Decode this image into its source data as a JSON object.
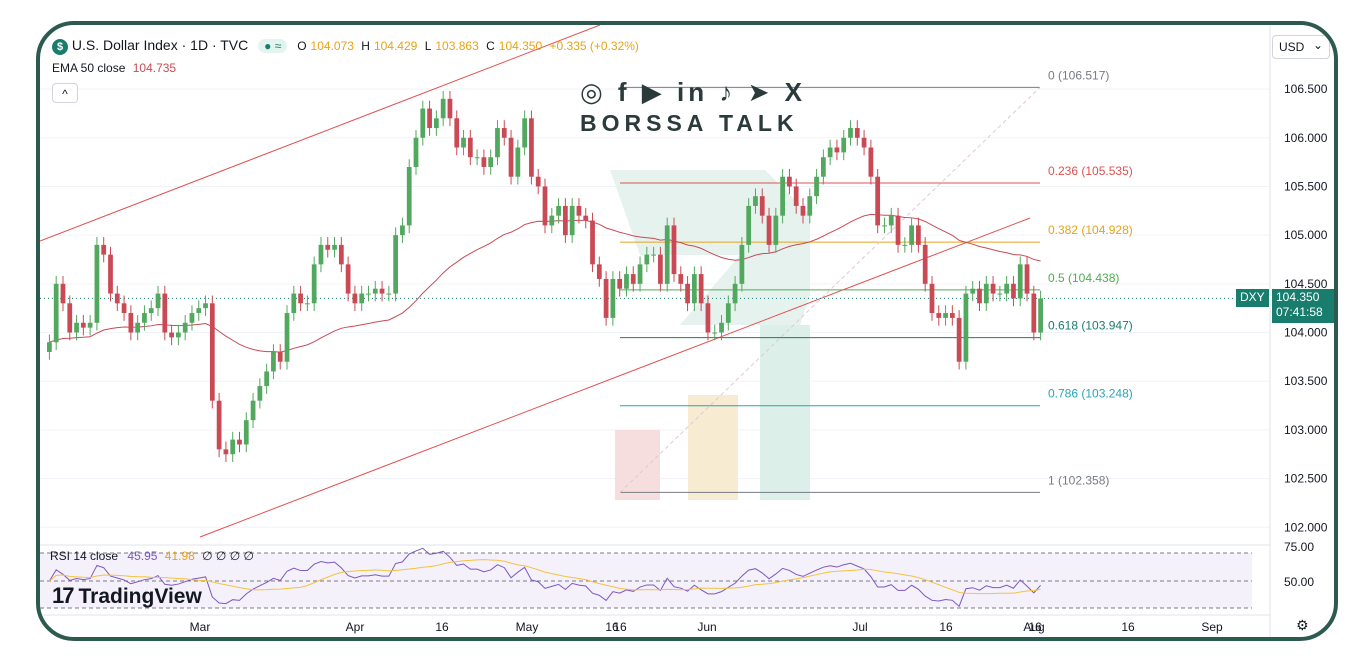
{
  "header": {
    "title": "U.S. Dollar Index · 1D · TVC",
    "open_label": "O",
    "open": "104.073",
    "high_label": "H",
    "high": "104.429",
    "low_label": "L",
    "low": "103.863",
    "close_label": "C",
    "close": "104.350",
    "change": "+0.335 (+0.32%)",
    "ema_label": "EMA 50 close",
    "ema_value": "104.735",
    "currency": "USD",
    "collapse_glyph": "^",
    "currency_glyph": "⌄",
    "pill_glyph": "● ≈"
  },
  "watermark": {
    "social": "◎ f ▶ in ♪ ➤ X",
    "name": "BORSSA TALK"
  },
  "brand": {
    "name": "TradingView",
    "mark": "17"
  },
  "price_badge": {
    "symbol": "DXY",
    "price": "104.350",
    "countdown": "07:41:58"
  },
  "rsi": {
    "label": "RSI 14 close",
    "rsi_value": "45.95",
    "ma_value": "41.98",
    "extras": "∅ ∅ ∅ ∅",
    "levels": [
      "75.00",
      "50.00"
    ]
  },
  "colors": {
    "up": "#52a85e",
    "down": "#c94a55",
    "ema": "#c94a55",
    "rsi": "#7e57c2",
    "rsi_ma": "#f5c242",
    "frame": "#2d5a4e"
  },
  "chart_data": {
    "type": "candlestick",
    "title": "U.S. Dollar Index · 1D · TVC",
    "ylim": [
      101.9,
      106.85
    ],
    "y_ticks": [
      "106.500",
      "106.000",
      "105.500",
      "105.000",
      "104.500",
      "104.000",
      "103.500",
      "103.000",
      "102.500",
      "102.000"
    ],
    "x_ticks": [
      "Mar",
      "16",
      "Apr",
      "16",
      "May",
      "16",
      "Jun",
      "16",
      "Jul",
      "16",
      "Aug",
      "16",
      "Sep"
    ],
    "fib_levels": [
      {
        "label": "0 (106.517)",
        "value": 106.517,
        "color": "#787b86"
      },
      {
        "label": "0.236 (105.535)",
        "value": 105.535,
        "color": "#e05050"
      },
      {
        "label": "0.382 (104.928)",
        "value": 104.928,
        "color": "#e8a317"
      },
      {
        "label": "0.5 (104.438)",
        "value": 104.438,
        "color": "#4caf50"
      },
      {
        "label": "0.618 (103.947)",
        "value": 103.947,
        "color": "#197d6e"
      },
      {
        "label": "0.786 (103.248)",
        "value": 103.248,
        "color": "#26a6b8"
      },
      {
        "label": "1 (102.358)",
        "value": 102.358,
        "color": "#787b86"
      }
    ],
    "closes": [
      103.9,
      104.5,
      104.3,
      104.0,
      104.1,
      104.05,
      104.1,
      104.9,
      104.8,
      104.4,
      104.3,
      104.2,
      104.0,
      104.1,
      104.2,
      104.25,
      104.4,
      104.0,
      103.95,
      104.0,
      104.1,
      104.2,
      104.25,
      104.3,
      103.3,
      102.8,
      102.75,
      102.9,
      102.85,
      103.1,
      103.3,
      103.45,
      103.6,
      103.8,
      103.7,
      104.2,
      104.4,
      104.3,
      104.3,
      104.7,
      104.9,
      104.85,
      104.9,
      104.7,
      104.4,
      104.3,
      104.4,
      104.4,
      104.45,
      104.4,
      104.4,
      105.0,
      105.1,
      105.7,
      106.0,
      106.3,
      106.1,
      106.2,
      106.4,
      106.2,
      105.9,
      106.0,
      105.8,
      105.8,
      105.7,
      105.8,
      106.1,
      106.0,
      105.6,
      105.9,
      106.2,
      105.6,
      105.5,
      105.1,
      105.2,
      105.3,
      105.0,
      105.3,
      105.2,
      105.15,
      104.7,
      104.55,
      104.15,
      104.55,
      104.45,
      104.6,
      104.5,
      104.7,
      104.8,
      104.8,
      104.5,
      105.1,
      104.6,
      104.5,
      104.3,
      104.6,
      104.3,
      104.0,
      104.0,
      104.1,
      104.3,
      104.5,
      104.9,
      105.3,
      105.4,
      105.2,
      104.9,
      105.2,
      105.6,
      105.5,
      105.3,
      105.2,
      105.4,
      105.6,
      105.8,
      105.9,
      105.85,
      106.0,
      106.1,
      106.0,
      105.9,
      105.6,
      105.1,
      105.1,
      105.2,
      104.9,
      104.9,
      105.1,
      104.9,
      104.5,
      104.2,
      104.15,
      104.2,
      104.15,
      103.7,
      104.4,
      104.45,
      104.3,
      104.5,
      104.4,
      104.4,
      104.5,
      104.35,
      104.7,
      104.4,
      104.0,
      104.35
    ]
  }
}
